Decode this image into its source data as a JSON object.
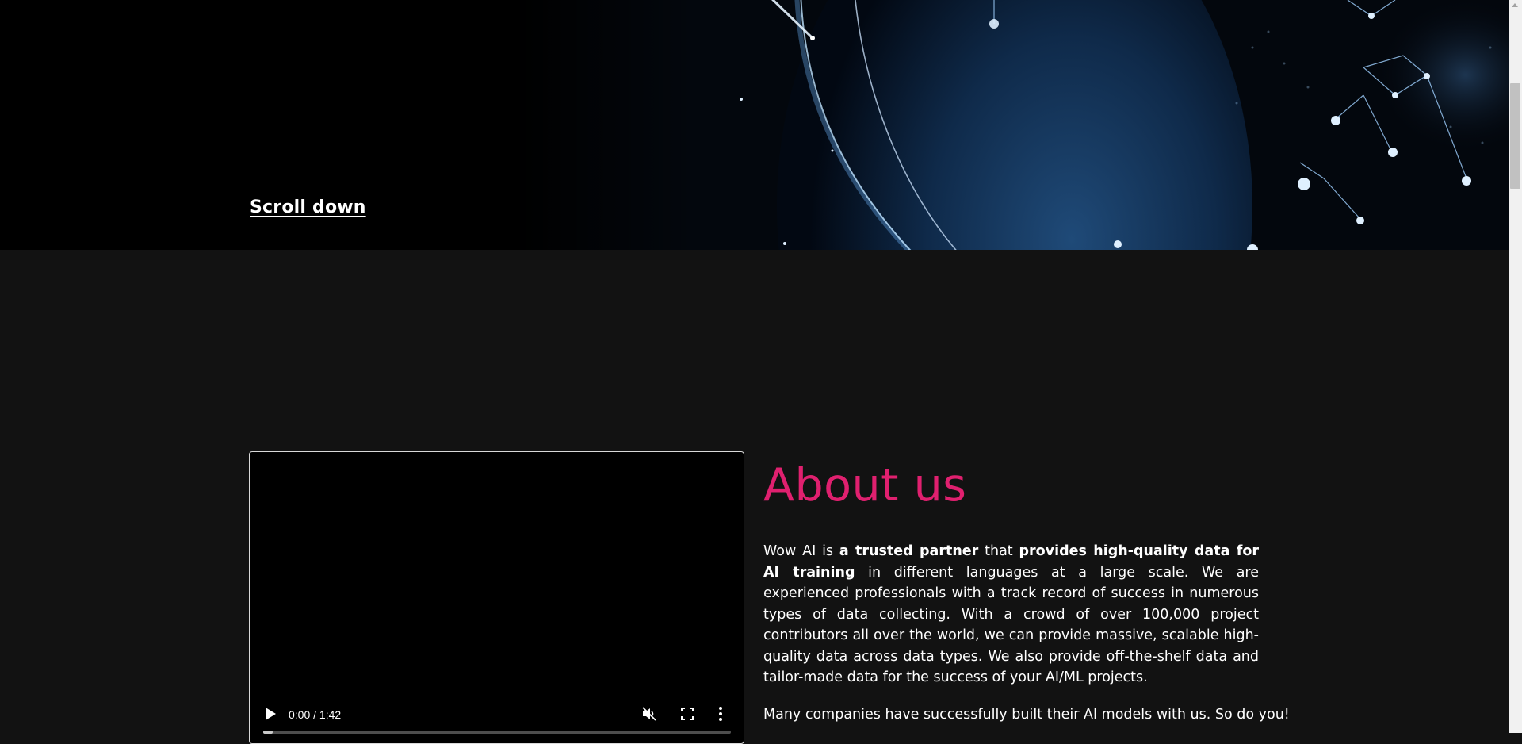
{
  "hero": {
    "scroll_label": "Scroll down"
  },
  "video": {
    "time": "0:00 / 1:42",
    "progress": 0,
    "controls": [
      "play-icon",
      "mute-icon",
      "fullscreen-icon",
      "more-options-icon"
    ]
  },
  "about": {
    "title": "About us",
    "p1": {
      "s1": "Wow AI is ",
      "b1": "a trusted partner",
      "s2": " that ",
      "b2": "provides high-quality data for AI training",
      "s3": " in different languages at a large scale. We are experienced professionals with a track record of success in numerous types of data collecting. With a crowd of over 100,000 project contributors all over the world, we can provide massive, scalable high-quality data across data types. We also provide off-the-shelf data and tailor-made data for the success of your AI/ML projects."
    },
    "p2": "Many companies have successfully built their AI models with us. So do you!"
  },
  "colors": {
    "accent": "#e0206f",
    "section_bg": "#121212",
    "hero_bg": "#000000"
  }
}
